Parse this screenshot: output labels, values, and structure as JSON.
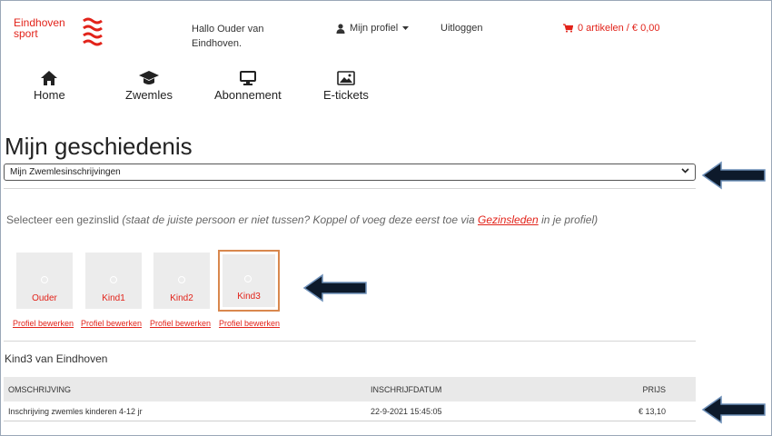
{
  "header": {
    "logo_line1": "Eindhoven",
    "logo_line2": "sport",
    "greeting_line1": "Hallo Ouder van",
    "greeting_line2": "Eindhoven.",
    "profile_label": "Mijn profiel",
    "logout_label": "Uitloggen",
    "cart_label": "0 artikelen / € 0,00"
  },
  "nav": [
    {
      "label": "Home",
      "icon": "home-icon"
    },
    {
      "label": "Zwemles",
      "icon": "graduation-cap-icon"
    },
    {
      "label": "Abonnement",
      "icon": "monitor-icon"
    },
    {
      "label": "E-tickets",
      "icon": "image-icon"
    }
  ],
  "page_title": "Mijn geschiedenis",
  "history_select": {
    "selected": "Mijn Zwemlesinschrijvingen"
  },
  "instruction": {
    "text": "Selecteer een gezinslid",
    "hint_before": "(staat de juiste persoon er niet tussen? Koppel of voeg deze eerst toe via",
    "link": "Gezinsleden",
    "hint_after": "in je profiel)"
  },
  "members": [
    {
      "name": "Ouder",
      "edit": "Profiel bewerken"
    },
    {
      "name": "Kind1",
      "edit": "Profiel bewerken"
    },
    {
      "name": "Kind2",
      "edit": "Profiel bewerken"
    },
    {
      "name": "Kind3",
      "edit": "Profiel bewerken"
    }
  ],
  "selected_member": "Kind3 van Eindhoven",
  "table": {
    "columns": [
      "OMSCHRIJVING",
      "INSCHRIJFDATUM",
      "PRIJS"
    ],
    "rows": [
      [
        "Inschrijving zwemles kinderen 4-12 jr",
        "22-9-2021 15:45:05",
        "€ 13,10"
      ]
    ]
  },
  "colors": {
    "accent": "#e2231a",
    "selected_border": "#d9884e",
    "arrow": "#0d1a2b"
  }
}
